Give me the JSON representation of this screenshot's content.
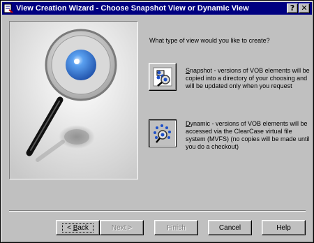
{
  "window": {
    "title": "View Creation Wizard - Choose Snapshot View or Dynamic View",
    "help_glyph": "?",
    "close_glyph": "✕",
    "icons": {
      "app": "wizard-app-icon",
      "help": "question-icon",
      "close": "close-icon"
    }
  },
  "illustration": {
    "icon": "magnifying-glass-icon"
  },
  "prompt": "What type of view would you like to create?",
  "options": [
    {
      "id": "snapshot",
      "icon": "snapshot-view-icon",
      "accel": "S",
      "text": "napshot - versions of VOB elements will be copied into a directory of your choosing and will be updated only when you request",
      "selected": false
    },
    {
      "id": "dynamic",
      "icon": "dynamic-view-icon",
      "accel": "D",
      "text": "ynamic - versions of VOB elements will be accessed via the ClearCase virtual file system (MVFS) (no copies will be made until you do a checkout)",
      "selected": true
    }
  ],
  "buttons": {
    "back": {
      "accel": "< ",
      "accel_char": "B",
      "rest": "ack",
      "enabled": true
    },
    "next": {
      "label": "Next >",
      "enabled": false
    },
    "finish": {
      "label": "Finish",
      "enabled": false
    },
    "cancel": {
      "label": "Cancel",
      "enabled": true
    },
    "help": {
      "label": "Help",
      "enabled": true
    }
  },
  "colors": {
    "titlebar": "#000080",
    "lens": "#3a7fd8",
    "face": "#c0c0c0"
  }
}
